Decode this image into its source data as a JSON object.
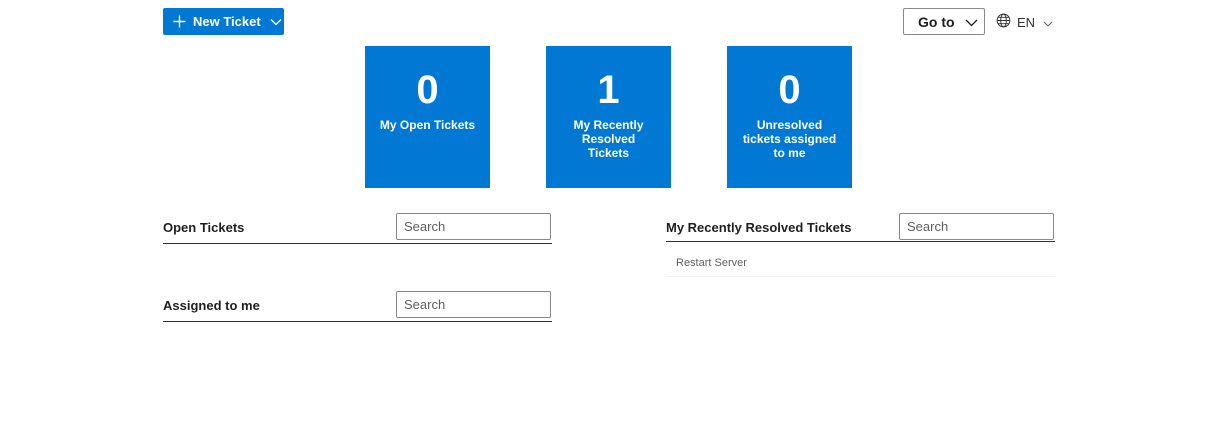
{
  "toolbar": {
    "new_ticket_label": "New Ticket",
    "goto_label": "Go to",
    "language_code": "EN"
  },
  "tiles": [
    {
      "count": "0",
      "title": "My Open Tickets"
    },
    {
      "count": "1",
      "title": "My Recently Resolved Tickets"
    },
    {
      "count": "0",
      "title": "Unresolved tickets assigned to me"
    }
  ],
  "sections": {
    "open_tickets": {
      "title": "Open Tickets",
      "search_placeholder": "Search"
    },
    "assigned_to_me": {
      "title": "Assigned to me",
      "search_placeholder": "Search"
    },
    "recently_resolved": {
      "title": "My Recently Resolved Tickets",
      "search_placeholder": "Search",
      "items": [
        "Restart Server"
      ]
    }
  },
  "colors": {
    "accent": "#0078d4",
    "divider": "#323130",
    "muted_text": "#605e5c"
  },
  "icons": {
    "new_ticket": "plus-icon",
    "menus": "chevron-down-icon",
    "language": "globe-icon"
  }
}
